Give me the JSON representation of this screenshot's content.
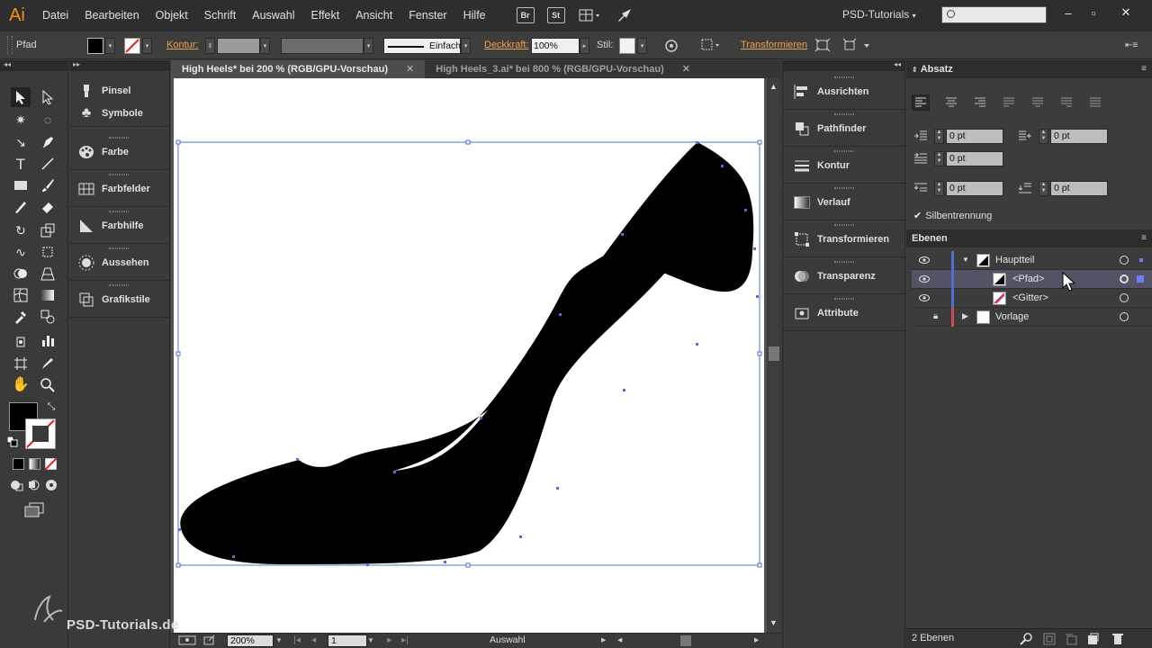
{
  "app": {
    "logo": "Ai",
    "workspace": "PSD-Tutorials",
    "watermark": "PSD-Tutorials.de"
  },
  "menu": [
    "Datei",
    "Bearbeiten",
    "Objekt",
    "Schrift",
    "Auswahl",
    "Effekt",
    "Ansicht",
    "Fenster",
    "Hilfe"
  ],
  "menubar_icons": {
    "bridge": "Br",
    "stock": "St"
  },
  "control": {
    "object_type": "Pfad",
    "kontur_label": "Kontur:",
    "stroke_profile": "Einfach",
    "deckkraft_label": "Deckkraft:",
    "deckkraft_value": "100%",
    "stil_label": "Stil:",
    "transform_link": "Transformieren"
  },
  "tabs": [
    {
      "label": "High Heels* bei 200 % (RGB/GPU-Vorschau)",
      "active": true
    },
    {
      "label": "High Heels_3.ai* bei 800 % (RGB/GPU-Vorschau)",
      "active": false
    }
  ],
  "left_panels": [
    "Pinsel",
    "Symbole",
    "Farbe",
    "Farbfelder",
    "Farbhilfe",
    "Aussehen",
    "Grafikstile"
  ],
  "right_panels": [
    "Ausrichten",
    "Pathfinder",
    "Kontur",
    "Verlauf",
    "Transformieren",
    "Transparenz",
    "Attribute"
  ],
  "absatz": {
    "title": "Absatz",
    "fields": [
      "0 pt",
      "0 pt",
      "0 pt",
      "0 pt",
      "0 pt"
    ],
    "hyphenation_label": "Silbentrennung",
    "hyphenation_checked": true
  },
  "ebenen": {
    "title": "Ebenen",
    "layers": [
      {
        "name": "Hauptteil",
        "color": "#4f6fd6",
        "expanded": true,
        "locked": false,
        "indent": 0
      },
      {
        "name": "<Pfad>",
        "color": "#4f6fd6",
        "selected": true,
        "indent": 1
      },
      {
        "name": "<Gitter>",
        "color": "#4f6fd6",
        "indent": 1
      },
      {
        "name": "Vorlage",
        "color": "#d14b5e",
        "locked": true,
        "indent": 0
      }
    ],
    "footer_count": "2 Ebenen"
  },
  "status": {
    "zoom": "200%",
    "artboard": "1",
    "mode": "Auswahl"
  },
  "colors": {
    "accent_orange": "#f79600",
    "selection_blue": "#4f6fd6",
    "path_fill": "#000000"
  }
}
